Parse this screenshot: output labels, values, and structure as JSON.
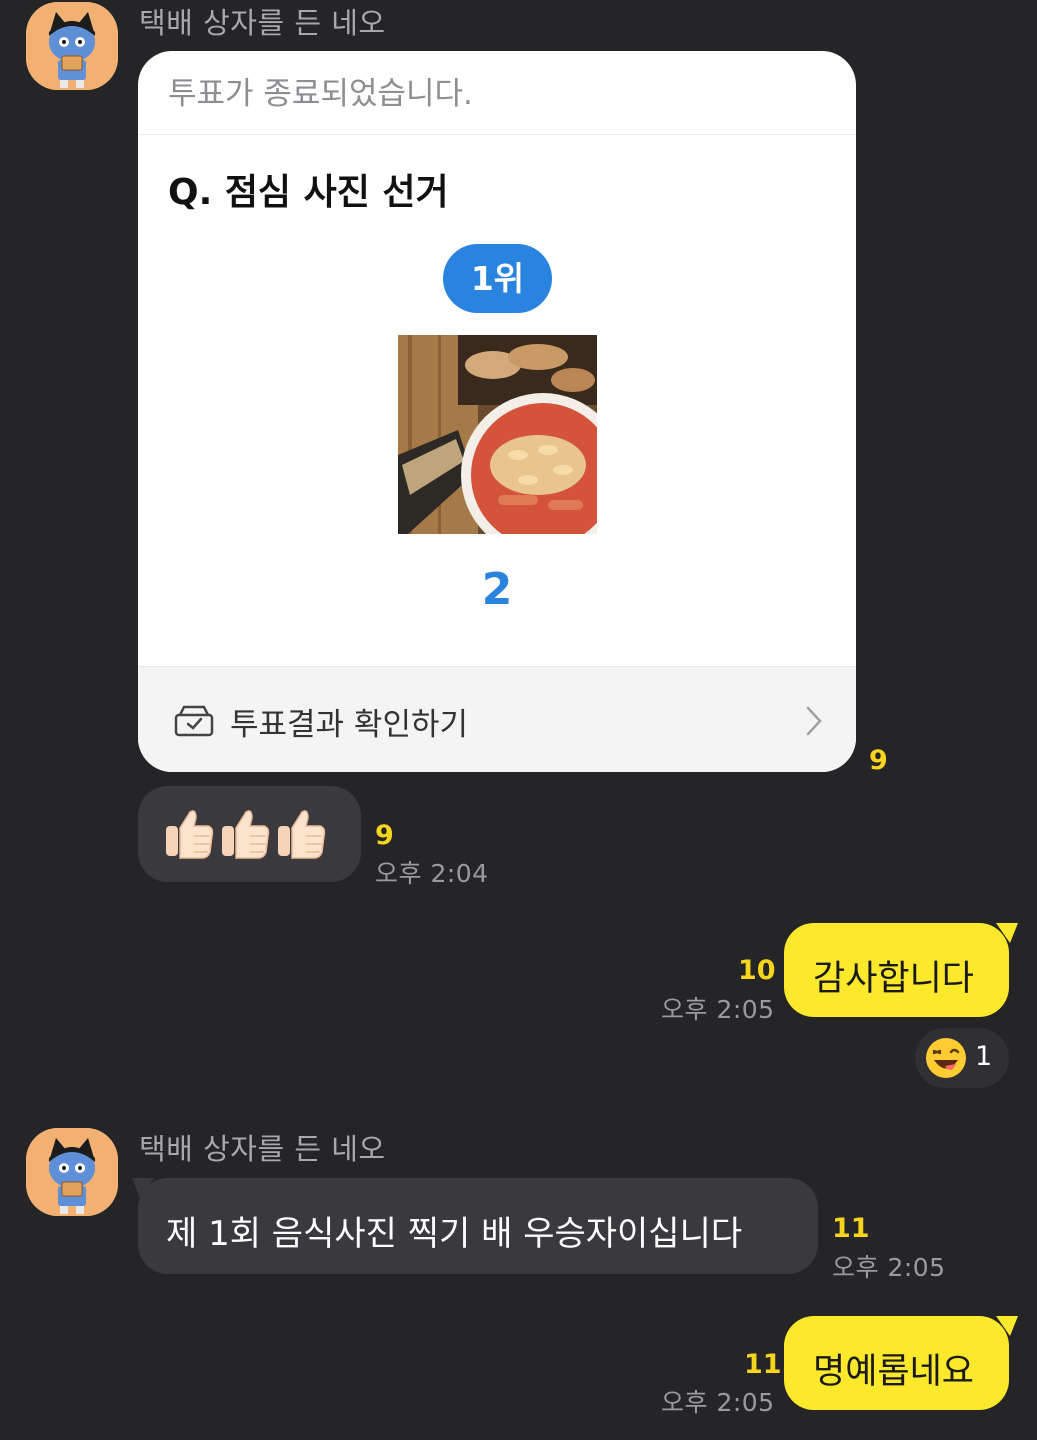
{
  "messages": {
    "m1": {
      "sender": "택배 상자를 든 네오"
    },
    "poll": {
      "status": "투표가 종료되었습니다.",
      "question": "Q. 점심 사진 선거",
      "rank_badge": "1위",
      "vote_count": "2",
      "footer_label": "투표결과 확인하기",
      "unread": "9"
    },
    "m2": {
      "unread": "9",
      "time": "오후 2:04"
    },
    "m3": {
      "text": "감사합니다",
      "unread": "10",
      "time": "오후 2:05",
      "reaction_count": "1"
    },
    "m4": {
      "sender": "택배 상자를 든 네오",
      "text": "제 1회 음식사진 찍기 배 우승자이십니다",
      "unread": "11",
      "time": "오후 2:05"
    },
    "m5": {
      "text": "명예롭네요",
      "unread": "11",
      "time": "오후 2:05"
    }
  },
  "colors": {
    "background": "#252528",
    "my_bubble": "#fde92c",
    "their_bubble": "#3a3a3e",
    "unread": "#f7d51c",
    "poll_accent": "#2a84df"
  },
  "icons": [
    "neo-avatar",
    "ballot-box-icon",
    "chevron-right-icon",
    "thumbs-up-emoji",
    "laughing-face-emoji"
  ]
}
